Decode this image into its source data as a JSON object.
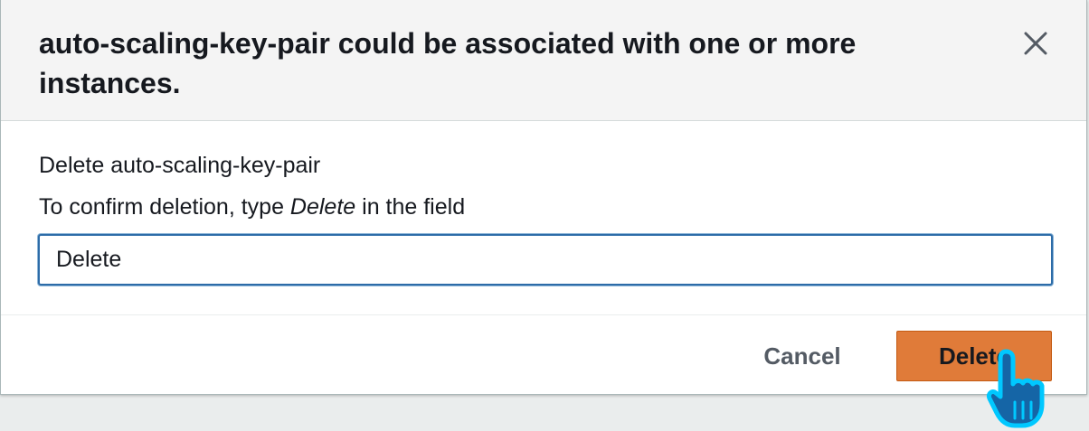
{
  "dialog": {
    "title": "auto-scaling-key-pair could be associated with one or more instances.",
    "close_icon": "close-icon",
    "delete_target_text": "Delete auto-scaling-key-pair",
    "confirm_prefix": "To confirm deletion, type ",
    "confirm_keyword": "Delete",
    "confirm_suffix": " in the field",
    "input_value": "Delete"
  },
  "footer": {
    "cancel_label": "Cancel",
    "delete_label": "Delete"
  },
  "colors": {
    "primary_button": "#e07b39",
    "input_focus_border": "#2d6ca8",
    "header_background": "#f4f4f4",
    "cursor_highlight": "#00c8ff"
  },
  "cursor": {
    "icon": "pointer-hand-cursor-icon"
  }
}
